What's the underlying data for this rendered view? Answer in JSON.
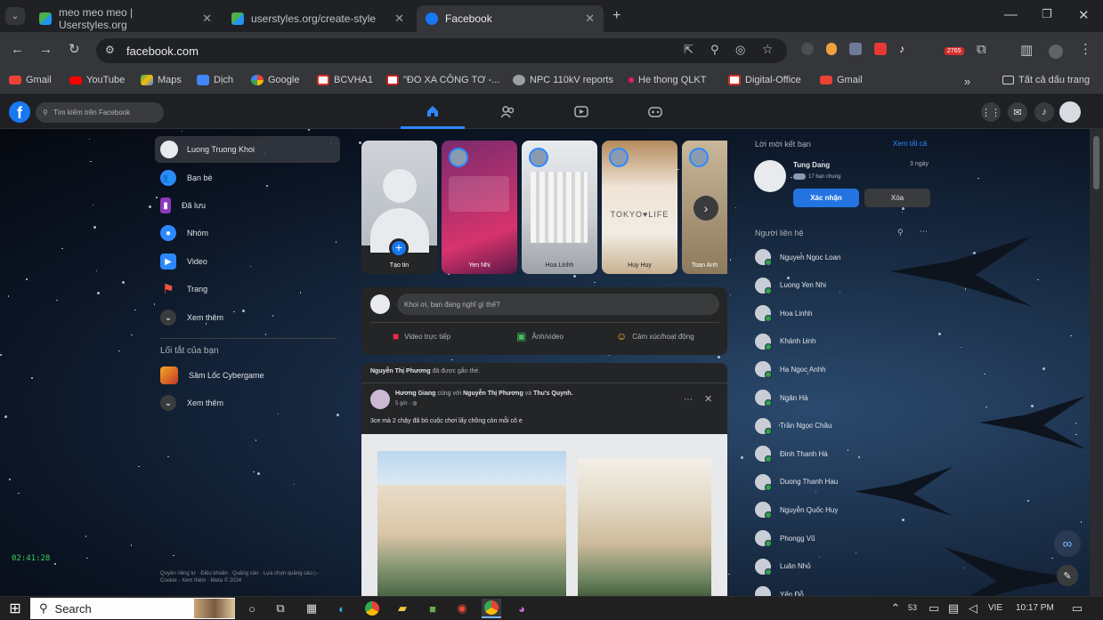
{
  "browser": {
    "tabs": [
      {
        "title": "meo meo meo | Userstyles.org"
      },
      {
        "title": "userstyles.org/create-style"
      },
      {
        "title": "Facebook"
      }
    ],
    "url": "facebook.com",
    "extension_badge": "2765",
    "bookmarks": [
      {
        "label": "Gmail",
        "color": "#ea4335"
      },
      {
        "label": "YouTube",
        "color": "#ff0000"
      },
      {
        "label": "Maps",
        "color": "#34a853"
      },
      {
        "label": "Dịch",
        "color": "#4285f4"
      },
      {
        "label": "Google",
        "color": "#fbbc05"
      },
      {
        "label": "BCVHA1",
        "color": "#d93025"
      },
      {
        "label": "\"ĐO XA CÔNG TƠ -...",
        "color": "#c5221f"
      },
      {
        "label": "NPC 110kV reports",
        "color": "#9aa0a6"
      },
      {
        "label": "He thong QLKT",
        "color": "#e91e63"
      },
      {
        "label": "Digital-Office",
        "color": "#d93025"
      },
      {
        "label": "Gmail",
        "color": "#ea4335"
      }
    ],
    "all_bookmarks": "Tất cả dấu trang"
  },
  "fb": {
    "search_placeholder": "Tìm kiếm trên Facebook",
    "brand_color": "#1877f2",
    "left_nav": {
      "profile": "Luong Truong Khoi",
      "items": [
        "Bạn bè",
        "Đã lưu",
        "Nhóm",
        "Video",
        "Trang",
        "Xem thêm"
      ],
      "shortcuts_title": "Lối tắt của bạn",
      "shortcuts": [
        "Sâm Lốc Cybergame",
        "Xem thêm"
      ],
      "footer": "Quyền riêng tư · Điều khoản · Quảng cáo · Lựa chọn quảng cáo ▷ · Cookie · Xem thêm · Meta © 2024",
      "clock": "02:41:28"
    },
    "stories": {
      "create_label": "Tạo tin",
      "items": [
        {
          "name": "Yen Nhi"
        },
        {
          "name": "Hoa Linhh"
        },
        {
          "name": "Huy Huy"
        },
        {
          "name": "Toan Anh"
        }
      ],
      "tokyo_sign": "TOKYO♥LIFE"
    },
    "composer": {
      "placeholder": "Khoi ơi, bạn đang nghĩ gì thế?",
      "actions": [
        "Video trực tiếp",
        "Ảnh/video",
        "Cảm xúc/hoạt động"
      ]
    },
    "post": {
      "tagged_name": "Nguyễn Thị Phương",
      "tagged_text": "đã được gắn thẻ.",
      "author": "Hương Giang",
      "with_text": "cùng với",
      "with1": "Nguyễn Thị Phương",
      "and_text": "và",
      "with2": "Thu's Quynh.",
      "time": "5 giờ · ",
      "body": "3ce mà 2 chậy đã bỏ cuộc chơi lấy chồng còn mỗi cô e"
    },
    "right": {
      "friend_requests_title": "Lời mời kết bạn",
      "see_all": "Xem tất cả",
      "request_name": "Tung Dang",
      "request_time": "3 ngày",
      "mutual": "17 bạn chung",
      "confirm": "Xác nhận",
      "delete": "Xóa",
      "contacts_title": "Người liên hệ",
      "contacts": [
        "Nguyeh Ngoc Loan",
        "Luong Yen Nhi",
        "Hoa Linhh",
        "Khánh Linh",
        "Ha Ngoc Anhh",
        "Ngân Hà",
        "Trần Ngọc Châu",
        "Đinh Thanh Hà",
        "Duong Thanh Hau",
        "Nguyễn Quốc Huy",
        "Phongg Vũ",
        "Luân Nhỏ",
        "Yến Đỗ"
      ]
    }
  },
  "taskbar": {
    "search_label": "Search",
    "lang": "VIE",
    "time": "10:17 PM",
    "badge": "53"
  }
}
